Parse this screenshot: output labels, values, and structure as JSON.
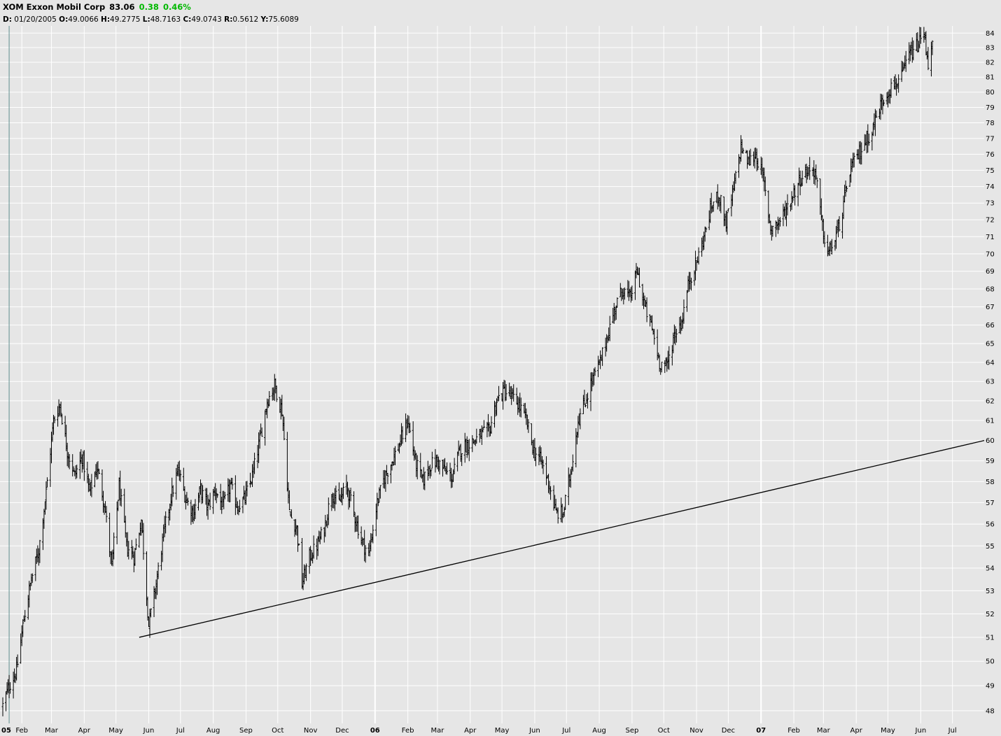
{
  "header": {
    "symbol_name": "XOM Exxon Mobil Corp",
    "last": "83.06",
    "change": "0.38",
    "change_pct": "0.46%",
    "change_color": "#00b800",
    "readout_d_label": "D:",
    "readout_date": "01/20/2005",
    "readout_o_label": "O:",
    "readout_o": "49.0066",
    "readout_h_label": "H:",
    "readout_h": "49.2775",
    "readout_l_label": "L:",
    "readout_l": "48.7163",
    "readout_c_label": "C:",
    "readout_c": "49.0743",
    "readout_r_label": "R:",
    "readout_r": "0.5612",
    "readout_y_label": "Y:",
    "readout_y": "75.6089"
  },
  "colors": {
    "background": "#e6e6e6",
    "grid": "#ffffff",
    "bars": "#000000",
    "trendline": "#000000",
    "cursor_line": "#5f8f8f"
  },
  "chart_data": {
    "type": "ohlc",
    "title": "XOM Exxon Mobil Corp",
    "y_scale": "log",
    "ylim": [
      47.5,
      84.5
    ],
    "y_ticks": [
      48,
      49,
      50,
      51,
      52,
      53,
      54,
      55,
      56,
      57,
      58,
      59,
      60,
      61,
      62,
      63,
      64,
      65,
      66,
      67,
      68,
      69,
      70,
      71,
      72,
      73,
      74,
      75,
      76,
      77,
      78,
      79,
      80,
      81,
      82,
      83,
      84
    ],
    "x_axis": "date",
    "xlim": [
      "2005-01-14",
      "2007-07-31"
    ],
    "x_ticks": [
      {
        "date": "2005-01-01",
        "label": "05",
        "year": true
      },
      {
        "date": "2005-02-01",
        "label": "Feb"
      },
      {
        "date": "2005-03-01",
        "label": "Mar"
      },
      {
        "date": "2005-04-01",
        "label": "Apr"
      },
      {
        "date": "2005-05-01",
        "label": "May"
      },
      {
        "date": "2005-06-01",
        "label": "Jun"
      },
      {
        "date": "2005-07-01",
        "label": "Jul"
      },
      {
        "date": "2005-08-01",
        "label": "Aug"
      },
      {
        "date": "2005-09-01",
        "label": "Sep"
      },
      {
        "date": "2005-10-01",
        "label": "Oct"
      },
      {
        "date": "2005-11-01",
        "label": "Nov"
      },
      {
        "date": "2005-12-01",
        "label": "Dec"
      },
      {
        "date": "2006-01-01",
        "label": "06",
        "year": true
      },
      {
        "date": "2006-02-01",
        "label": "Feb"
      },
      {
        "date": "2006-03-01",
        "label": "Mar"
      },
      {
        "date": "2006-04-01",
        "label": "Apr"
      },
      {
        "date": "2006-05-01",
        "label": "May"
      },
      {
        "date": "2006-06-01",
        "label": "Jun"
      },
      {
        "date": "2006-07-01",
        "label": "Jul"
      },
      {
        "date": "2006-08-01",
        "label": "Aug"
      },
      {
        "date": "2006-09-01",
        "label": "Sep"
      },
      {
        "date": "2006-10-01",
        "label": "Oct"
      },
      {
        "date": "2006-11-01",
        "label": "Nov"
      },
      {
        "date": "2006-12-01",
        "label": "Dec"
      },
      {
        "date": "2007-01-01",
        "label": "07",
        "year": true
      },
      {
        "date": "2007-02-01",
        "label": "Feb"
      },
      {
        "date": "2007-03-01",
        "label": "Mar"
      },
      {
        "date": "2007-04-01",
        "label": "Apr"
      },
      {
        "date": "2007-05-01",
        "label": "May"
      },
      {
        "date": "2007-06-01",
        "label": "Jun"
      },
      {
        "date": "2007-07-01",
        "label": "Jul"
      }
    ],
    "cursor_date": "2005-01-20",
    "price_path": [
      [
        "2005-01-14",
        48.2
      ],
      [
        "2005-01-20",
        49.0
      ],
      [
        "2005-01-27",
        49.6
      ],
      [
        "2005-02-03",
        51.8
      ],
      [
        "2005-02-10",
        53.5
      ],
      [
        "2005-02-17",
        54.8
      ],
      [
        "2005-02-24",
        57.5
      ],
      [
        "2005-03-03",
        61.0
      ],
      [
        "2005-03-09",
        61.8
      ],
      [
        "2005-03-16",
        59.5
      ],
      [
        "2005-03-23",
        58.3
      ],
      [
        "2005-03-30",
        59.2
      ],
      [
        "2005-04-06",
        57.5
      ],
      [
        "2005-04-13",
        58.7
      ],
      [
        "2005-04-20",
        57.0
      ],
      [
        "2005-04-27",
        54.0
      ],
      [
        "2005-05-04",
        57.8
      ],
      [
        "2005-05-11",
        55.0
      ],
      [
        "2005-05-18",
        54.5
      ],
      [
        "2005-05-25",
        56.2
      ],
      [
        "2005-06-01",
        51.5
      ],
      [
        "2005-06-08",
        53.3
      ],
      [
        "2005-06-15",
        55.5
      ],
      [
        "2005-06-22",
        57.3
      ],
      [
        "2005-06-29",
        58.5
      ],
      [
        "2005-07-06",
        57.2
      ],
      [
        "2005-07-13",
        56.5
      ],
      [
        "2005-07-20",
        57.6
      ],
      [
        "2005-07-27",
        56.8
      ],
      [
        "2005-08-03",
        57.6
      ],
      [
        "2005-08-10",
        56.8
      ],
      [
        "2005-08-17",
        57.8
      ],
      [
        "2005-08-24",
        56.8
      ],
      [
        "2005-08-31",
        57.2
      ],
      [
        "2005-09-07",
        58.3
      ],
      [
        "2005-09-14",
        60.0
      ],
      [
        "2005-09-21",
        62.0
      ],
      [
        "2005-09-28",
        62.8
      ],
      [
        "2005-10-05",
        61.5
      ],
      [
        "2005-10-12",
        56.5
      ],
      [
        "2005-10-19",
        55.8
      ],
      [
        "2005-10-24",
        53.3
      ],
      [
        "2005-10-31",
        54.5
      ],
      [
        "2005-11-07",
        55.0
      ],
      [
        "2005-11-14",
        55.8
      ],
      [
        "2005-11-21",
        57.5
      ],
      [
        "2005-11-28",
        57.0
      ],
      [
        "2005-12-05",
        57.8
      ],
      [
        "2005-12-12",
        56.5
      ],
      [
        "2005-12-19",
        55.3
      ],
      [
        "2005-12-26",
        54.6
      ],
      [
        "2006-01-03",
        57.0
      ],
      [
        "2006-01-10",
        58.2
      ],
      [
        "2006-01-17",
        59.0
      ],
      [
        "2006-01-24",
        59.8
      ],
      [
        "2006-02-01",
        61.0
      ],
      [
        "2006-02-08",
        59.0
      ],
      [
        "2006-02-15",
        58.0
      ],
      [
        "2006-02-22",
        58.8
      ],
      [
        "2006-03-01",
        59.0
      ],
      [
        "2006-03-08",
        58.5
      ],
      [
        "2006-03-15",
        58.2
      ],
      [
        "2006-03-22",
        59.5
      ],
      [
        "2006-03-29",
        59.8
      ],
      [
        "2006-04-05",
        60.0
      ],
      [
        "2006-04-12",
        60.3
      ],
      [
        "2006-04-19",
        60.5
      ],
      [
        "2006-04-26",
        62.0
      ],
      [
        "2006-05-03",
        62.5
      ],
      [
        "2006-05-10",
        62.2
      ],
      [
        "2006-05-17",
        61.8
      ],
      [
        "2006-05-24",
        61.0
      ],
      [
        "2006-05-31",
        59.5
      ],
      [
        "2006-06-07",
        59.0
      ],
      [
        "2006-06-14",
        58.0
      ],
      [
        "2006-06-21",
        56.5
      ],
      [
        "2006-06-28",
        56.5
      ],
      [
        "2006-07-05",
        58.5
      ],
      [
        "2006-07-12",
        61.0
      ],
      [
        "2006-07-19",
        62.0
      ],
      [
        "2006-07-26",
        63.2
      ],
      [
        "2006-08-02",
        64.0
      ],
      [
        "2006-08-09",
        65.5
      ],
      [
        "2006-08-16",
        67.0
      ],
      [
        "2006-08-23",
        68.0
      ],
      [
        "2006-08-30",
        67.5
      ],
      [
        "2006-09-06",
        69.0
      ],
      [
        "2006-09-13",
        67.0
      ],
      [
        "2006-09-20",
        65.8
      ],
      [
        "2006-09-27",
        64.0
      ],
      [
        "2006-10-04",
        63.8
      ],
      [
        "2006-10-11",
        65.5
      ],
      [
        "2006-10-18",
        66.2
      ],
      [
        "2006-10-25",
        68.5
      ],
      [
        "2006-11-01",
        69.5
      ],
      [
        "2006-11-08",
        71.0
      ],
      [
        "2006-11-15",
        72.8
      ],
      [
        "2006-11-22",
        73.5
      ],
      [
        "2006-11-29",
        71.8
      ],
      [
        "2006-12-06",
        73.8
      ],
      [
        "2006-12-13",
        76.5
      ],
      [
        "2006-12-20",
        75.5
      ],
      [
        "2006-12-27",
        76.0
      ],
      [
        "2007-01-03",
        74.5
      ],
      [
        "2007-01-10",
        71.5
      ],
      [
        "2007-01-17",
        71.8
      ],
      [
        "2007-01-24",
        72.5
      ],
      [
        "2007-01-31",
        73.5
      ],
      [
        "2007-02-07",
        74.5
      ],
      [
        "2007-02-14",
        75.0
      ],
      [
        "2007-02-21",
        75.0
      ],
      [
        "2007-02-28",
        71.5
      ],
      [
        "2007-03-05",
        70.0
      ],
      [
        "2007-03-12",
        70.8
      ],
      [
        "2007-03-19",
        72.5
      ],
      [
        "2007-03-26",
        75.0
      ],
      [
        "2007-04-02",
        75.8
      ],
      [
        "2007-04-09",
        76.8
      ],
      [
        "2007-04-16",
        77.5
      ],
      [
        "2007-04-23",
        79.0
      ],
      [
        "2007-04-30",
        80.0
      ],
      [
        "2007-05-07",
        80.5
      ],
      [
        "2007-05-14",
        81.0
      ],
      [
        "2007-05-21",
        82.5
      ],
      [
        "2007-05-28",
        83.0
      ],
      [
        "2007-06-04",
        84.0
      ],
      [
        "2007-06-08",
        82.0
      ],
      [
        "2007-06-12",
        83.06
      ]
    ],
    "trendline": {
      "start": [
        "2005-05-23",
        51.0
      ],
      "end": [
        "2007-07-31",
        60.0
      ]
    }
  }
}
